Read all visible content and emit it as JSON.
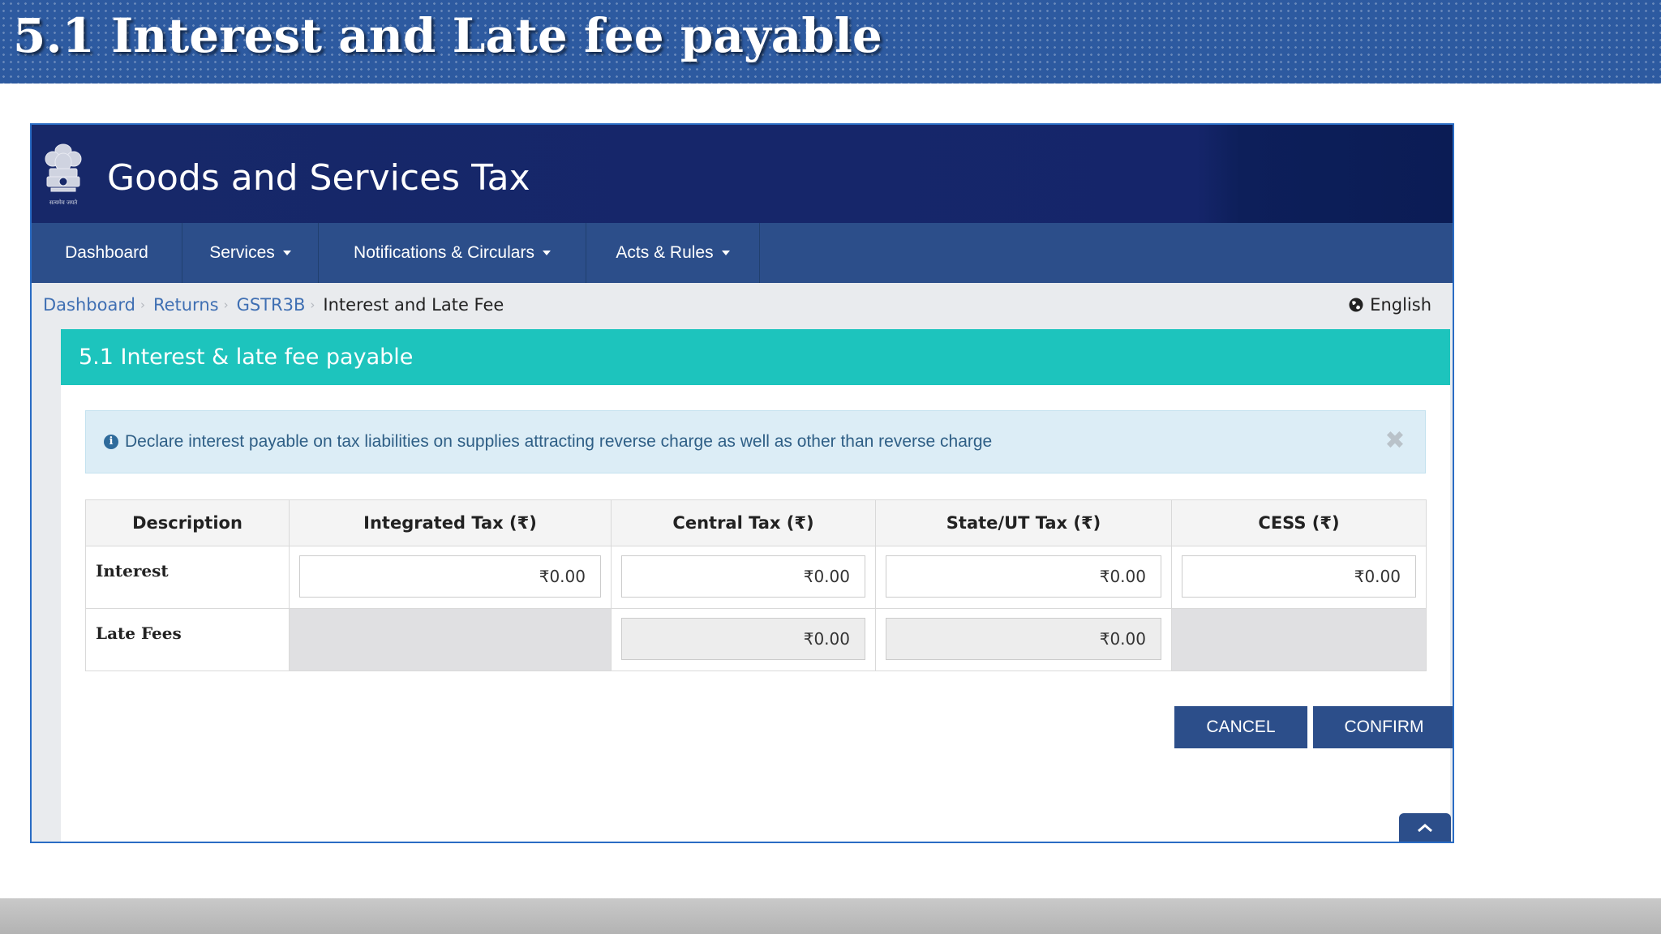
{
  "slide": {
    "title": "5.1 Interest and Late fee payable"
  },
  "header": {
    "title": "Goods and Services Tax",
    "emblem_icon": "national-emblem-icon"
  },
  "nav": {
    "items": [
      {
        "label": "Dashboard",
        "has_dropdown": false
      },
      {
        "label": "Services",
        "has_dropdown": true
      },
      {
        "label": "Notifications & Circulars",
        "has_dropdown": true
      },
      {
        "label": "Acts & Rules",
        "has_dropdown": true
      }
    ]
  },
  "breadcrumb": {
    "items": [
      "Dashboard",
      "Returns",
      "GSTR3B"
    ],
    "current": "Interest and Late Fee"
  },
  "language": {
    "label": "English",
    "icon": "globe-icon"
  },
  "panel": {
    "heading": "5.1 Interest & late fee payable",
    "alert": {
      "text": "Declare interest payable on tax liabilities on supplies attracting reverse charge as well as other than reverse charge",
      "icon": "info-icon",
      "close_icon": "close-icon"
    }
  },
  "table": {
    "headers": [
      "Description",
      "Integrated Tax (₹)",
      "Central Tax (₹)",
      "State/UT Tax (₹)",
      "CESS (₹)"
    ],
    "rows": [
      {
        "label": "Interest",
        "integrated": "₹0.00",
        "central": "₹0.00",
        "state": "₹0.00",
        "cess": "₹0.00"
      },
      {
        "label": "Late Fees",
        "integrated": null,
        "central": "₹0.00",
        "state": "₹0.00",
        "cess": null
      }
    ]
  },
  "buttons": {
    "cancel": "CANCEL",
    "confirm": "CONFIRM"
  },
  "colors": {
    "header_bg": "#172869",
    "nav_bg": "#2c4e8a",
    "panel_heading_bg": "#1dc4bd",
    "alert_bg": "#dcedf6",
    "button_bg": "#2c4e8a"
  }
}
